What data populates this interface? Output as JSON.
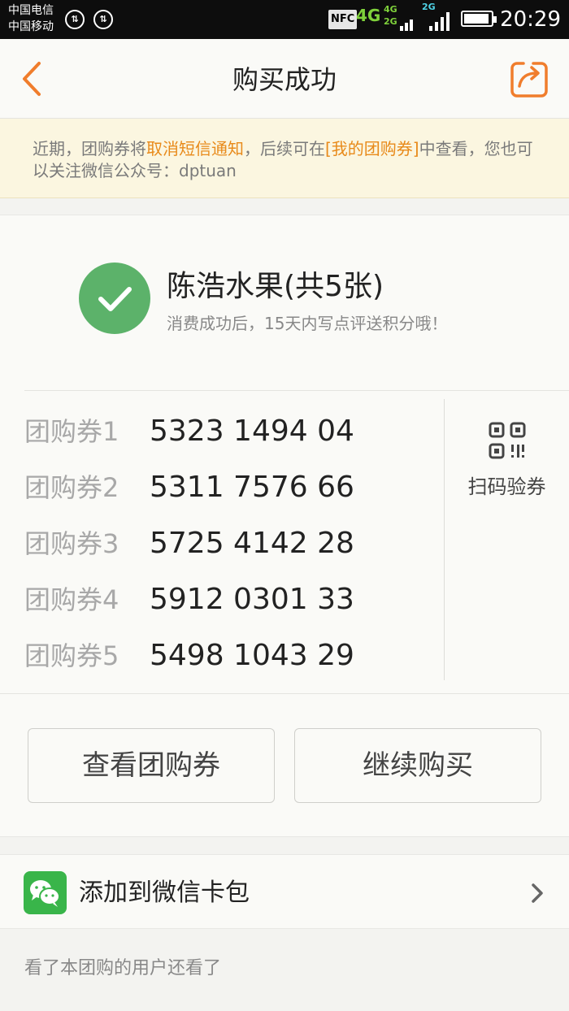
{
  "status_bar": {
    "carrier_1": "中国电信",
    "carrier_2": "中国移动",
    "nfc_label": "NFC",
    "network_4g": "4G",
    "network_stack_top": "4G",
    "network_stack_bottom": "2G",
    "network_2g": "2G",
    "time": "20:29"
  },
  "header": {
    "title": "购买成功",
    "back_icon": "chevron-left-icon",
    "share_icon": "share-icon",
    "accent_color": "#f07d2c"
  },
  "notice": {
    "part1": "近期，团购券将",
    "highlight1": "取消短信通知",
    "part2": "，后续可在",
    "highlight2": "[我的团购券]",
    "part3": "中查看，您也可以关注微信公众号：dptuan",
    "highlight_color": "#e88a1a"
  },
  "order": {
    "shop_name": "陈浩水果(共5张)",
    "hint": "消费成功后，15天内写点评送积分哦！",
    "success_color": "#5cb26a",
    "vouchers": [
      {
        "label": "团购券1",
        "code": "5323 1494 04"
      },
      {
        "label": "团购券2",
        "code": "5311 7576 66"
      },
      {
        "label": "团购券3",
        "code": "5725 4142 28"
      },
      {
        "label": "团购券4",
        "code": "5912 0301 33"
      },
      {
        "label": "团购券5",
        "code": "5498 1043 29"
      }
    ],
    "scan_label": "扫码验券"
  },
  "actions": {
    "view_label": "查看团购券",
    "buy_label": "继续购买"
  },
  "wechat": {
    "label": "添加到微信卡包",
    "brand_color": "#39b54a"
  },
  "footer": {
    "also_viewed": "看了本团购的用户还看了"
  }
}
